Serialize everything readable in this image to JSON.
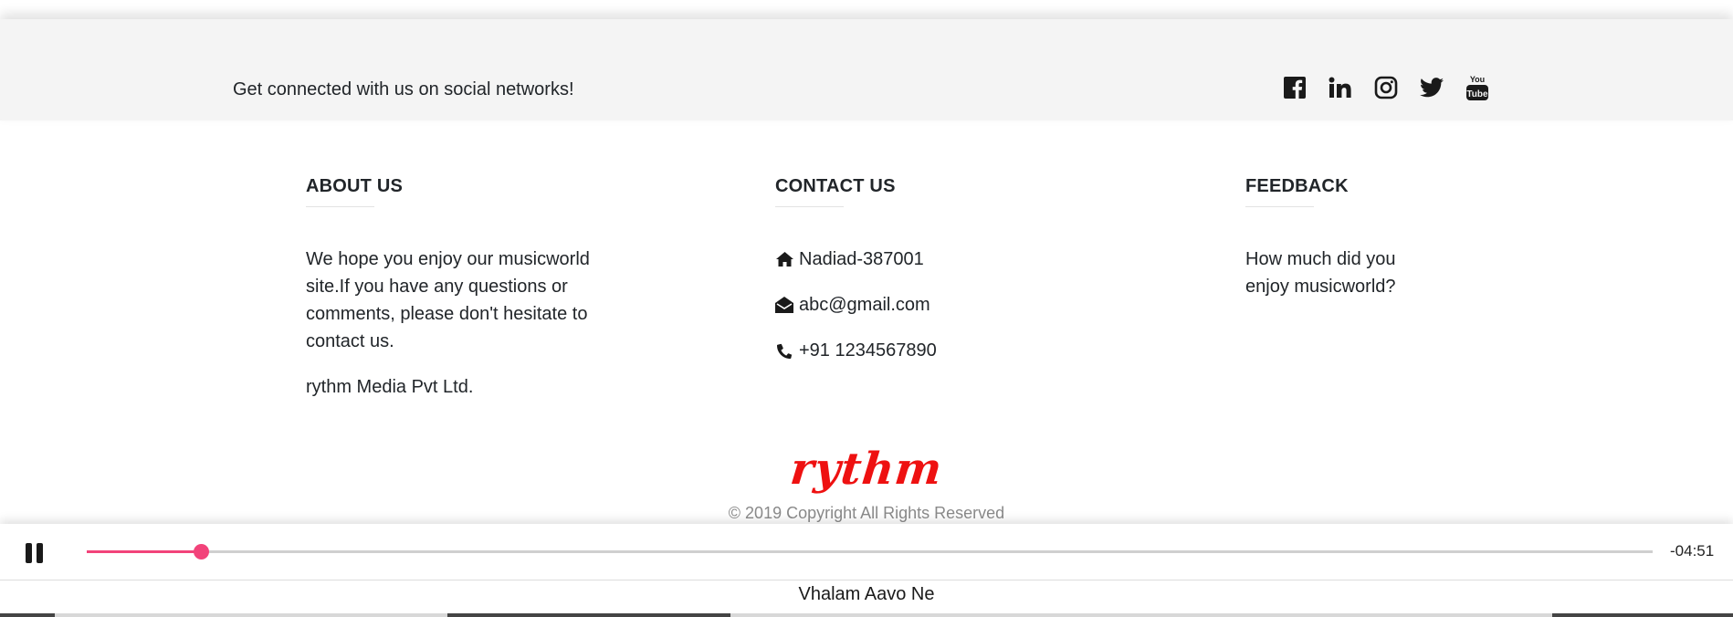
{
  "social": {
    "text": "Get connected with us on social networks!",
    "icons": [
      "facebook-icon",
      "linkedin-icon",
      "instagram-icon",
      "twitter-icon",
      "youtube-icon"
    ]
  },
  "about": {
    "title": "ABOUT US",
    "text": "We hope you enjoy our musicworld site.If you have any questions or comments, please don't hesitate to contact us.",
    "company": "rythm Media Pvt Ltd."
  },
  "contact": {
    "title": "CONTACT US",
    "address": "Nadiad-387001",
    "email": "abc@gmail.com",
    "phone": "+91 1234567890"
  },
  "feedback": {
    "title": "FEEDBACK",
    "text": "How much did you enjoy musicworld?"
  },
  "brand": "rythm",
  "copyright": "© 2019 Copyright All Rights Reserved",
  "player": {
    "state": "playing",
    "progress_percent": 7.3,
    "time_remaining": "-04:51",
    "track_title": "Vhalam Aavo Ne",
    "accent_color": "#f2437a"
  },
  "colors": {
    "social_bar_bg": "#f4f4f4",
    "brand": "#ee1111"
  }
}
